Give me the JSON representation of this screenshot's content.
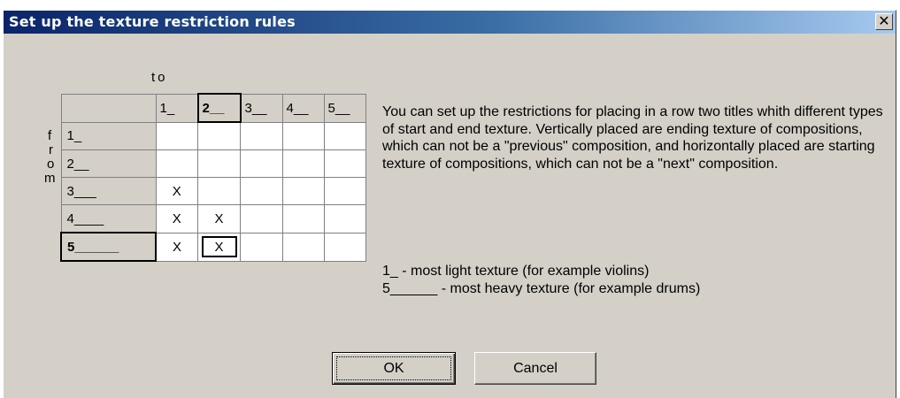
{
  "window": {
    "title": "Set up the texture restriction rules",
    "close_glyph": "✕"
  },
  "labels": {
    "to": "to",
    "from": [
      "f",
      "r",
      "o",
      "m"
    ]
  },
  "grid": {
    "columns": [
      "1_",
      "2__",
      "3__",
      "4__",
      "5__"
    ],
    "rows": [
      {
        "label": "1_",
        "cells": [
          "",
          "",
          "",
          "",
          ""
        ]
      },
      {
        "label": "2__",
        "cells": [
          "",
          "",
          "",
          "",
          ""
        ]
      },
      {
        "label": "3___",
        "cells": [
          "X",
          "",
          "",
          "",
          ""
        ]
      },
      {
        "label": "4____",
        "cells": [
          "X",
          "X",
          "",
          "",
          ""
        ]
      },
      {
        "label": "5______",
        "cells": [
          "X",
          "X",
          "",
          "",
          ""
        ]
      }
    ],
    "selected_column": 1,
    "selected_row": 4,
    "focused_cell": [
      4,
      1
    ]
  },
  "description": "You can set up the restrictions for placing in a row two titles whith different types of start and end texture. Vertically placed are ending texture of compositions, which can not be a \"previous\" composition, and horizontally placed are starting texture of compositions, which can not be a \"next\" composition.",
  "legend": [
    "1_ - most light texture (for example violins)",
    "5______ - most heavy texture (for example drums)"
  ],
  "buttons": {
    "ok": "OK",
    "cancel": "Cancel"
  }
}
